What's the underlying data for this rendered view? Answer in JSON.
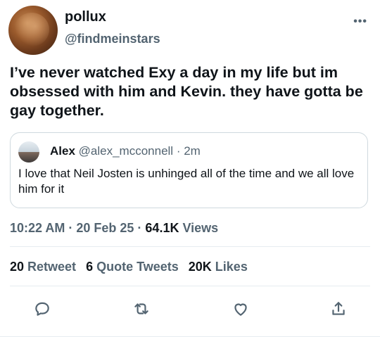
{
  "tweet": {
    "display_name": "pollux",
    "handle": "@findmeinstars",
    "more_label": "•••",
    "text": "I’ve never watched Exy a day in my life but im obsessed with him and Kevin. they have gotta be gay together.",
    "time": "10:22 AM",
    "sep1": " · ",
    "date": "20 Feb 25",
    "sep2": " · ",
    "views_count": "64.1K",
    "views_label": " Views"
  },
  "quote": {
    "name": "Alex",
    "handle": "@alex_mcconnell",
    "sep": " · ",
    "age": "2m",
    "text": "I love that Neil Josten is unhinged all of the time and we all love him for it"
  },
  "stats": {
    "retweets_count": "20",
    "retweets_label": " Retweet",
    "quotes_count": "6",
    "quotes_label": " Quote Tweets",
    "likes_count": "20K",
    "likes_label": " Likes"
  },
  "actions": {
    "icons": [
      "reply-icon",
      "retweet-icon",
      "like-icon",
      "share-icon"
    ]
  },
  "colors": {
    "text_primary": "#0f1419",
    "text_secondary": "#536471",
    "border": "#cfd9de",
    "divider": "#e6ecf0"
  }
}
